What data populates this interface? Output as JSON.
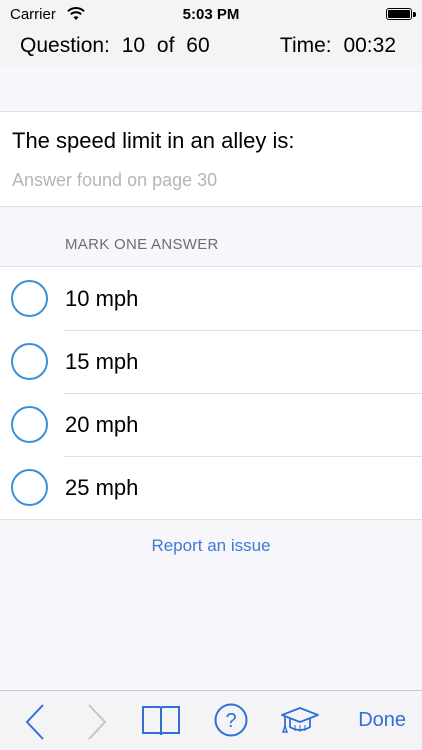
{
  "status_bar": {
    "carrier": "Carrier",
    "time": "5:03 PM",
    "battery_level": 1.0
  },
  "header": {
    "question_counter": "Question:  10 of 60",
    "timer": "Time:  00:32"
  },
  "question": {
    "text": "The speed limit in an alley is:",
    "reference": "Answer found on page 30"
  },
  "answers": {
    "header": "MARK ONE ANSWER",
    "options": [
      {
        "label": "10 mph",
        "selected": false
      },
      {
        "label": "15 mph",
        "selected": false
      },
      {
        "label": "20 mph",
        "selected": false
      },
      {
        "label": "25 mph",
        "selected": false
      }
    ]
  },
  "report_link": "Report an issue",
  "toolbar": {
    "icons": [
      "chevron-left-icon",
      "chevron-right-icon",
      "book-icon",
      "help-icon",
      "graduation-cap-icon"
    ],
    "done_label": "Done"
  },
  "colors": {
    "accent": "#2f6fd6",
    "radio_border": "#3b8fd8",
    "secondary_text": "#b5b5ba",
    "disabled_icon": "#c4c4c8"
  }
}
